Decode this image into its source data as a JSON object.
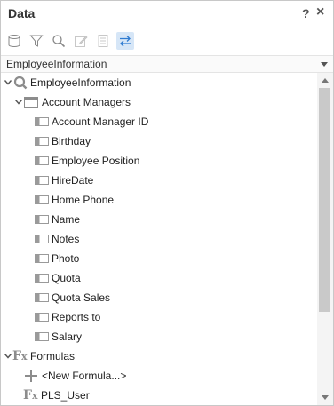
{
  "panel": {
    "title": "Data",
    "help_label": "?",
    "close_label": "×"
  },
  "toolbar": {
    "tools": [
      {
        "name": "database-icon",
        "active": false
      },
      {
        "name": "filter-icon",
        "active": false
      },
      {
        "name": "search-icon",
        "active": false
      },
      {
        "name": "edit-icon",
        "active": false
      },
      {
        "name": "document-icon",
        "active": false
      },
      {
        "name": "swap-arrows-icon",
        "active": true
      }
    ]
  },
  "source": {
    "selected": "EmployeeInformation"
  },
  "tree": {
    "query": {
      "label": "EmployeeInformation",
      "icon": "query-icon"
    },
    "table": {
      "label": "Account Managers",
      "icon": "table-icon"
    },
    "fields": [
      "Account Manager ID",
      "Birthday",
      "Employee Position",
      "HireDate",
      "Home Phone",
      "Name",
      "Notes",
      "Photo",
      "Quota",
      "Quota Sales",
      "Reports to",
      "Salary"
    ],
    "formulas": {
      "label": "Formulas",
      "icon": "fx-icon"
    },
    "new_formula": {
      "label": "<New Formula...>",
      "icon": "plus-icon"
    },
    "formula_items": [
      "PLS_User"
    ]
  },
  "colors": {
    "accent": "#2e7bd1",
    "icon_gray": "#888888",
    "field_icon": "#9a9a9a"
  }
}
